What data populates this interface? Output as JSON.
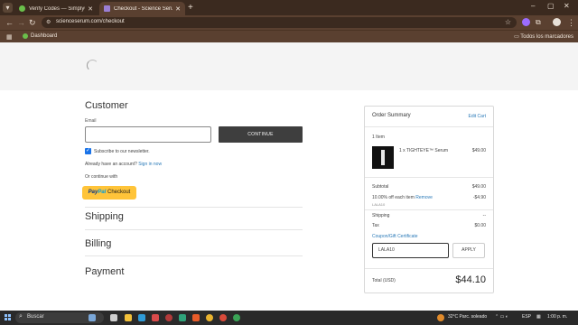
{
  "browser": {
    "tabs": [
      {
        "title": "Verify Codes — SimplyCodes",
        "active": false,
        "favicon_color": "#6abf4b"
      },
      {
        "title": "Checkout - Science Serum™",
        "active": true,
        "favicon_color": "#9b7fd4"
      }
    ],
    "url": "scienceserum.com/checkout",
    "bookmarks": [
      {
        "label": "Dashboard"
      }
    ],
    "all_bookmarks_label": "Todos los marcadores"
  },
  "checkout": {
    "customer_heading": "Customer",
    "email_label": "Email",
    "email_value": "",
    "continue_label": "CONTINUE",
    "newsletter_label": "Subscribe to our newsletter.",
    "newsletter_checked": true,
    "have_account_text": "Already have an account?",
    "sign_in_label": "Sign in now",
    "or_continue_text": "Or continue with",
    "paypal_label_1": "Pay",
    "paypal_label_2": "Pal",
    "paypal_label_3": "Checkout",
    "shipping_heading": "Shipping",
    "billing_heading": "Billing",
    "payment_heading": "Payment"
  },
  "summary": {
    "title": "Order Summary",
    "edit_label": "Edit Cart",
    "item_count": "1 Item",
    "product_name": "1 x TIGHTEYE™ Serum",
    "product_price": "$49.00",
    "subtotal_label": "Subtotal",
    "subtotal_value": "$49.00",
    "discount_label": "10.00% off each item",
    "remove_label": "Remove",
    "discount_value": "-$4.90",
    "discount_code": "LALA10",
    "shipping_label": "Shipping",
    "shipping_value": "--",
    "tax_label": "Tax",
    "tax_value": "$0.00",
    "coupon_label": "Coupon/Gift Certificate",
    "coupon_value": "LALA10",
    "apply_label": "APPLY",
    "total_label": "Total (USD)",
    "total_value": "$44.10"
  },
  "taskbar": {
    "search_label": "Buscar",
    "weather": "32°C  Parc. soleado",
    "lang": "ESP",
    "time": "1:00 p. m."
  }
}
